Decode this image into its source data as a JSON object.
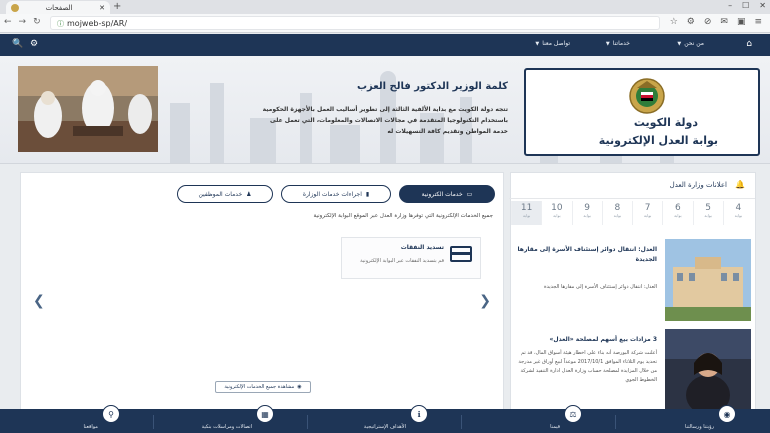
{
  "browser": {
    "tab_title": "الصفحات",
    "new_tab_symbol": "+",
    "url": "mojweb-sp/AR/"
  },
  "navbar": {
    "items": [
      {
        "label": "من نحن"
      },
      {
        "label": "خدماتنا"
      },
      {
        "label": "تواصل معنا"
      }
    ]
  },
  "hero": {
    "site_name_line1": "دولة الكويت",
    "site_name_line2": "بوابة العدل الإلكترونية",
    "minister_title": "كلمة الوزير الدكتور فالح العزب",
    "minister_text": "تتجه دولة الكويت مع بداية الألفية الثالثة إلى تطوير أساليب العمل بالأجهزة الحكومية باستخدام التكنولوجيا المتقدمة في مجالات الاتصالات والمعلومات، التي تعمل على خدمة المواطن وتقديم كافة التسهيلات له"
  },
  "announcements": {
    "title": "اعلانات وزارة العدل",
    "pages": [
      {
        "num": "4",
        "label": "بوابة"
      },
      {
        "num": "5",
        "label": "بوابة"
      },
      {
        "num": "6",
        "label": "بوابة"
      },
      {
        "num": "7",
        "label": "بوابة"
      },
      {
        "num": "8",
        "label": "بوابة"
      },
      {
        "num": "9",
        "label": "بوابة"
      },
      {
        "num": "10",
        "label": "بوابة"
      },
      {
        "num": "11",
        "label": "بوابة"
      }
    ],
    "news": [
      {
        "title": "العدل: انتقال دوائر إستئناف الأسرة إلى مقارها الجديدة",
        "desc": "العدل: انتقال دوائر إستئناف الأسرة إلى مقارها الجديدة"
      },
      {
        "title": "3 مزادات بيع أسهم لمصلحة «العدل»",
        "desc": "أعلنت شركة البورصة أنه بناء على اخطار هيئة أسواق المال، قد تم تحديد يوم الثلاثاء الموافق 2017/10/1 موعداً لبيع أوراق غير مدرجة من خلال المزايدة لمصلحة حساب وزارة العدل ادارة التنفيذ لشركة الخطوط الجوي"
      }
    ]
  },
  "services": {
    "tabs": [
      {
        "label": "خدمات الكترونية"
      },
      {
        "label": "اجراءات خدمات الوزارة"
      },
      {
        "label": "خدمات الموظفين"
      }
    ],
    "intro": "جميع الخدمات الإلكترونية التي توفرها وزارة العدل عبر الموقع البوابة الإلكترونية",
    "card_title": "تسديد النفقات",
    "card_desc": "قم بتسديد النفقات عبر البوابة الإلكترونية",
    "view_all": "مشاهدة جميع الخدمات الإلكترونية"
  },
  "bottom_bar": {
    "items": [
      {
        "label": "رؤيتنا ورسالتنا",
        "icon": "eye-icon"
      },
      {
        "label": "قيمنا",
        "icon": "scales-icon"
      },
      {
        "label": "الأهداف الإستراتيجية",
        "icon": "info-icon"
      },
      {
        "label": "اتصالات ومراسلات بنكية",
        "icon": "building-icon"
      },
      {
        "label": "مواقعنا",
        "icon": "location-pin-icon"
      }
    ]
  },
  "colors": {
    "primary": "#1e3556",
    "background": "#e9ecef"
  }
}
